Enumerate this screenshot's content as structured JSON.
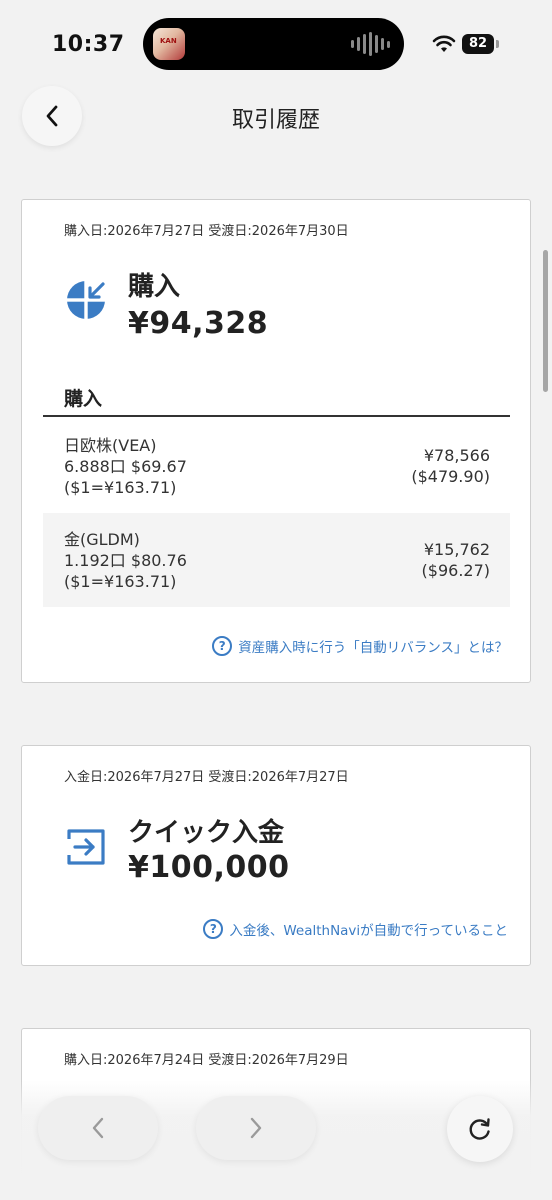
{
  "status_bar": {
    "time": "10:37",
    "battery": "82",
    "thumb_text": "KAN"
  },
  "header": {
    "title": "取引履歴"
  },
  "transactions": [
    {
      "dates": "購入日:2026年7月27日 受渡日:2026年7月30日",
      "type": "購入",
      "amount": "¥94,328",
      "icon": "pie-chart-arrow-icon",
      "section_title": "購入",
      "assets": [
        {
          "name": "日欧株(VEA)",
          "detail": "6.888口 $69.67",
          "rate": "($1=¥163.71)",
          "yen": "¥78,566",
          "usd": "($479.90)"
        },
        {
          "name": "金(GLDM)",
          "detail": "1.192口 $80.76",
          "rate": "($1=¥163.71)",
          "yen": "¥15,762",
          "usd": "($96.27)"
        }
      ],
      "help_link": "資産購入時に行う「自動リバランス」とは？"
    },
    {
      "dates": "入金日:2026年7月27日 受渡日:2026年7月27日",
      "type": "クイック入金",
      "amount": "¥100,000",
      "icon": "deposit-arrow-icon",
      "help_link": "入金後、WealthNaviが自動で行っていること"
    },
    {
      "dates": "購入日:2026年7月24日 受渡日:2026年7月29日"
    }
  ],
  "help_icon_glyph": "?",
  "colors": {
    "accent": "#3b7cc4",
    "background": "#f2f2f2",
    "card": "#ffffff"
  }
}
